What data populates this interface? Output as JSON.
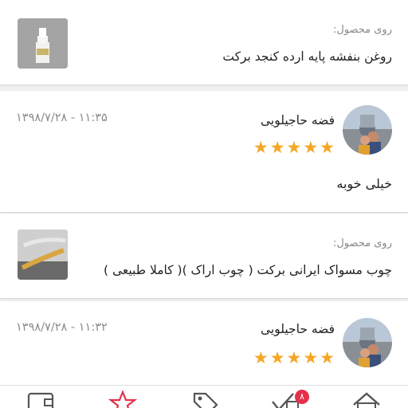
{
  "colors": {
    "accent": "#e5304a",
    "star": "#f5a623",
    "muted": "#8a8a8a"
  },
  "items": [
    {
      "type": "product",
      "on_label": "روی محصول:",
      "product_name": "روغن بنفشه پایه ارده کنجد برکت",
      "thumbnail_icon": "oil-bottle-thumbnail"
    },
    {
      "type": "review",
      "reviewer": "فضه حاجیلویی",
      "rating": 5,
      "timestamp": "۱۳۹۸/۷/۲۸ - ۱۱:۳۵",
      "comment": "خیلی خوبه"
    },
    {
      "type": "product",
      "on_label": "روی محصول:",
      "product_name": "چوب مسواک ایرانی برکت ( چوب اراک )( کاملا طبیعی )",
      "thumbnail_icon": "miswak-thumbnail"
    },
    {
      "type": "review",
      "reviewer": "فضه حاجیلویی",
      "rating": 5,
      "timestamp": "۱۳۹۸/۷/۲۸ - ۱۱:۳۲"
    }
  ],
  "stars": [
    "★",
    "★",
    "★",
    "★",
    "★"
  ],
  "bottom_nav": {
    "items": [
      "wallet-icon",
      "starred-icon",
      "tag-icon",
      "orders-icon",
      "home-icon"
    ],
    "orders_badge": "۸"
  }
}
